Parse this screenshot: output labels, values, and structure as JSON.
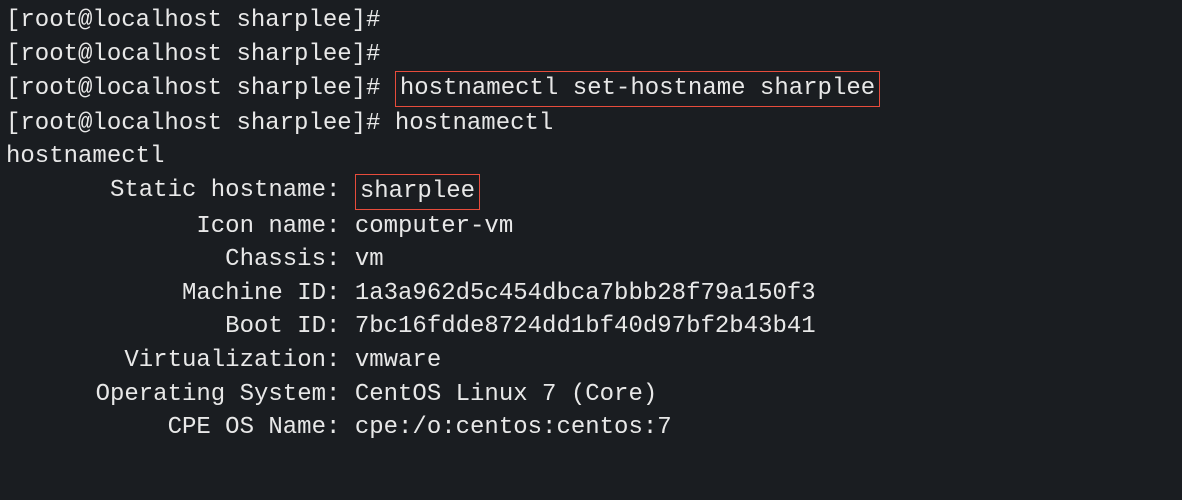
{
  "prompts": {
    "p1": "[root@localhost sharplee]# ",
    "p2": "[root@localhost sharplee]# ",
    "p3": "[root@localhost sharplee]# ",
    "p4": "[root@localhost sharplee]# "
  },
  "commands": {
    "cmd3": "hostnamectl set-hostname sharplee",
    "cmd4": "hostnamectl"
  },
  "output": {
    "echo": "hostnamectl",
    "labels": {
      "static_hostname": "Static hostname",
      "icon_name": "Icon name",
      "chassis": "Chassis",
      "machine_id": "Machine ID",
      "boot_id": "Boot ID",
      "virtualization": "Virtualization",
      "operating_system": "Operating System",
      "cpe_os_name": "CPE OS Name"
    },
    "values": {
      "static_hostname": "sharplee",
      "icon_name": "computer-vm",
      "chassis": "vm",
      "machine_id": "1a3a962d5c454dbca7bbb28f79a150f3",
      "boot_id": "7bc16fdde8724dd1bf40d97bf2b43b41",
      "virtualization": "vmware",
      "operating_system": "CentOS Linux 7 (Core)",
      "cpe_os_name": "cpe:/o:centos:centos:7"
    }
  },
  "sep": ": "
}
